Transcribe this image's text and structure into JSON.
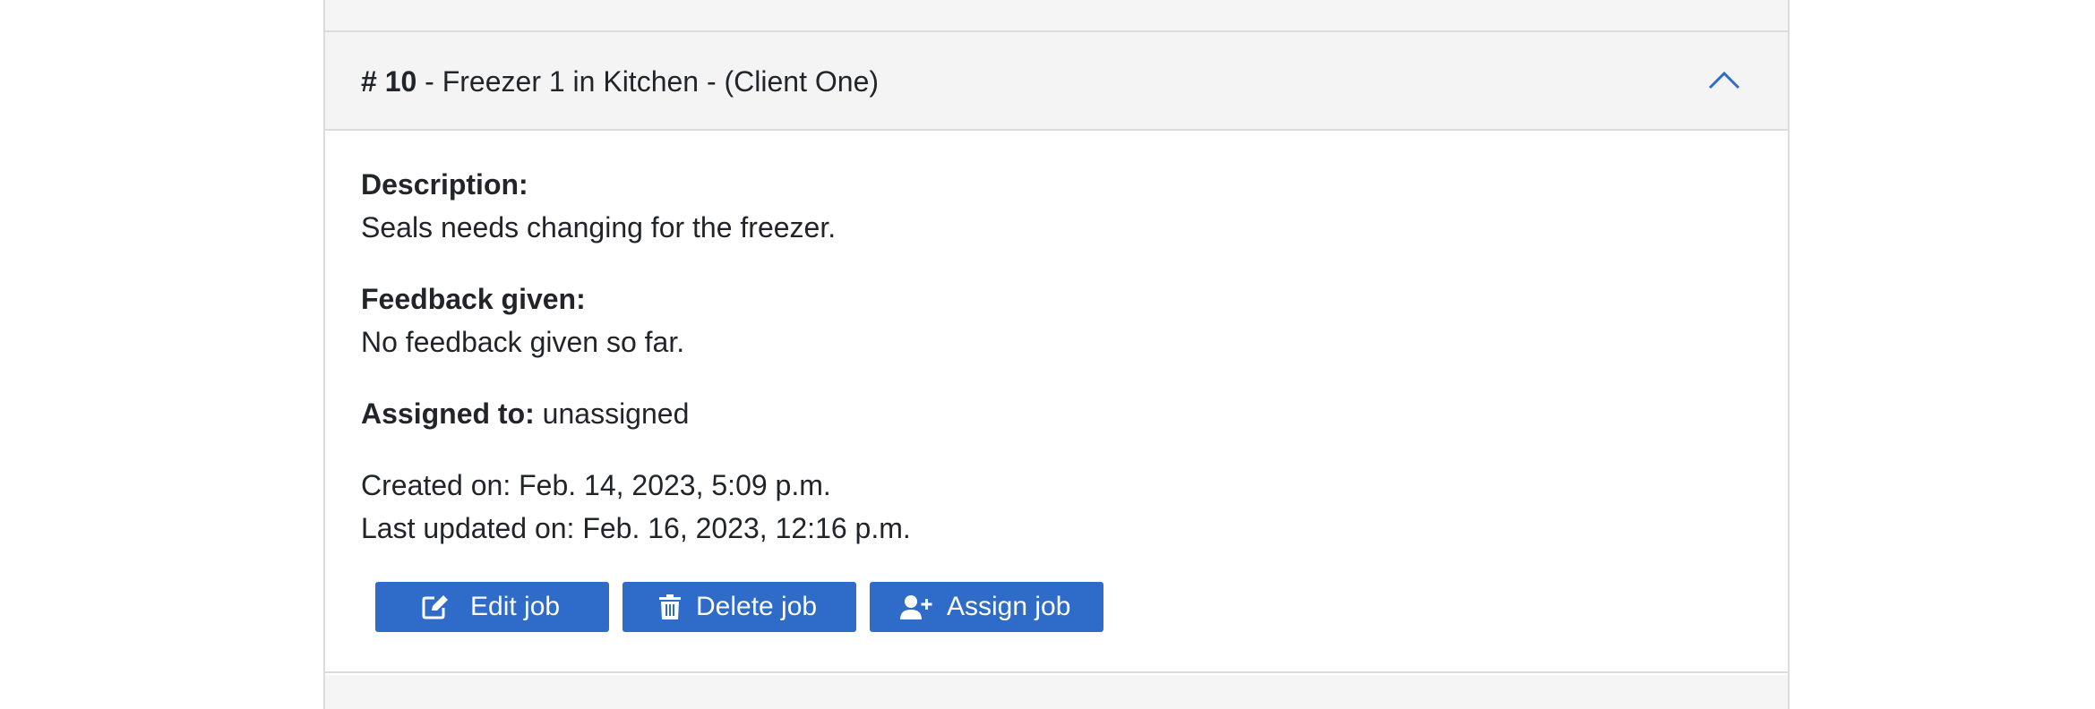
{
  "job": {
    "number_label": "# 10",
    "title_rest": " - Freezer 1 in Kitchen - (Client One)",
    "description_label": "Description:",
    "description_value": "Seals needs changing for the freezer.",
    "feedback_label": "Feedback given:",
    "feedback_value": "No feedback given so far.",
    "assigned_label": "Assigned to:",
    "assigned_value": "unassigned",
    "created_on": "Created on: Feb. 14, 2023, 5:09 p.m.",
    "last_updated_on": "Last updated on: Feb. 16, 2023, 12:16 p.m."
  },
  "actions": {
    "edit_label": "Edit job",
    "delete_label": "Delete job",
    "assign_label": "Assign job"
  },
  "colors": {
    "button_bg": "#2f6bc8",
    "chevron": "#2f6bc8",
    "header_bg": "#f4f4f4"
  },
  "icons": {
    "header": "chevron-up-icon",
    "edit": "edit-icon",
    "delete": "trash-icon",
    "assign": "user-plus-icon"
  }
}
